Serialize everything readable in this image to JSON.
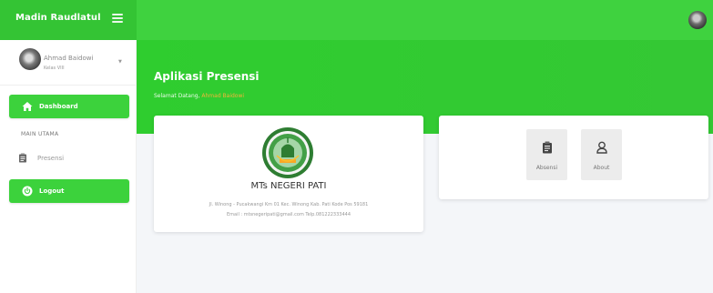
{
  "brand": {
    "title": "Madin Raudlatul"
  },
  "user": {
    "name": "Ahmad Baidowi",
    "class": "Kelas VIII"
  },
  "sidebar": {
    "dashboard_label": "Dashboard",
    "section_title": "MAIN UTAMA",
    "presensi_label": "Presensi",
    "logout_label": "Logout"
  },
  "hero": {
    "title": "Aplikasi Presensi",
    "welcome_prefix": "Selamat Datang, ",
    "welcome_name": "Ahmad Baidowi"
  },
  "school": {
    "name": "MTs NEGERI PATI",
    "address": "Jl. Winong - Pucakwangi Km 01 Kec. Winong Kab. Pati Kode Pos 59181",
    "contact": "Email : mtsnegeripati@gmail.com Telp.081222333444"
  },
  "menu": {
    "absensi_label": "Absensi",
    "about_label": "About"
  },
  "colors": {
    "accent": "#3cd23c",
    "brand_bg": "#34c434",
    "highlight": "#f2b33a",
    "icon": "#444444"
  },
  "icons": [
    "menu-icon",
    "user-avatar",
    "home-icon",
    "clipboard-icon",
    "power-icon",
    "person-icon",
    "school-logo"
  ]
}
